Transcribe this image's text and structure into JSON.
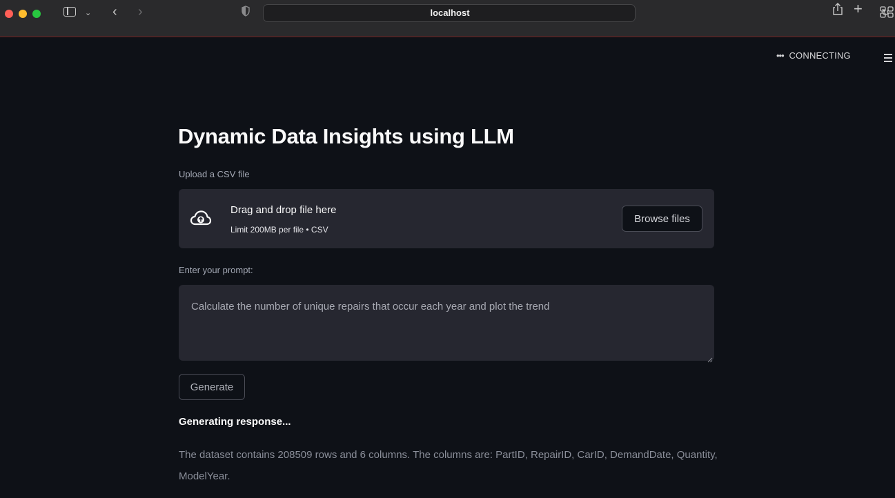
{
  "browser": {
    "address": "localhost",
    "icons": [
      "sidebar-toggle-icon",
      "chevron-down-icon",
      "back-icon",
      "forward-icon",
      "shield-icon",
      "reload-icon",
      "share-icon",
      "plus-icon",
      "tab-overview-icon"
    ]
  },
  "header": {
    "status": "CONNECTING"
  },
  "main": {
    "title": "Dynamic Data Insights using LLM",
    "upload": {
      "label": "Upload a CSV file",
      "drop_text": "Drag and drop file here",
      "limit_text": "Limit 200MB per file • CSV",
      "browse_label": "Browse files"
    },
    "prompt": {
      "label": "Enter your prompt:",
      "value": "Calculate the number of unique repairs that occur each year and plot the trend"
    },
    "generate_label": "Generate",
    "generating_text": "Generating response...",
    "summary_text": "The dataset contains 208509 rows and 6 columns. The columns are: PartID, RepairID, CarID, DemandDate, Quantity, ModelYear."
  },
  "colors": {
    "background": "#0e1117",
    "panel": "#262730",
    "text": "#fafafa"
  }
}
